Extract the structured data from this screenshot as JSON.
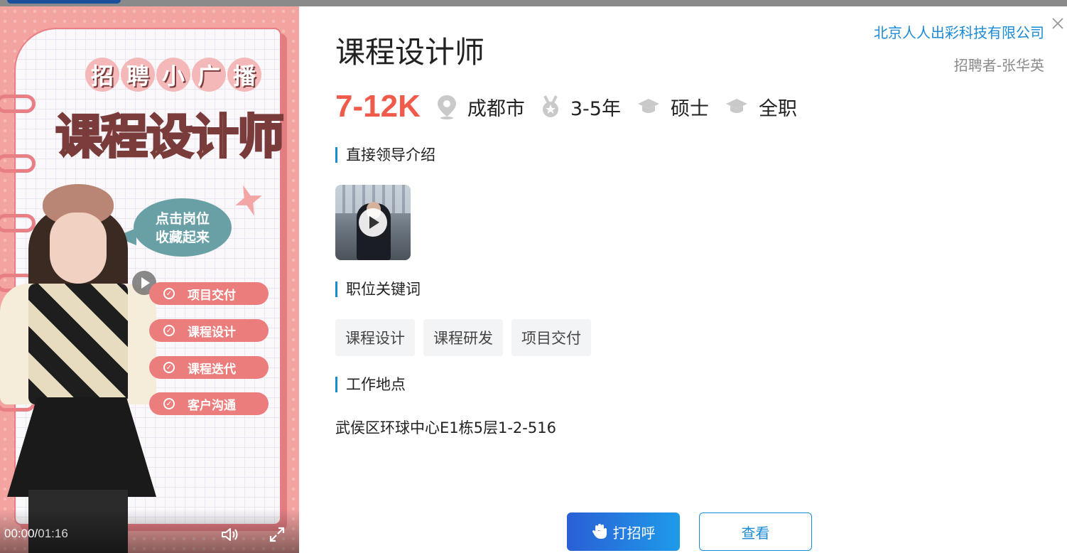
{
  "video": {
    "banner_chars": [
      "招",
      "聘",
      "小",
      "广",
      "播"
    ],
    "title": "课程设计师",
    "bubble_line1": "点击岗位",
    "bubble_line2": "收藏起来",
    "tags": [
      "项目交付",
      "课程设计",
      "课程迭代",
      "客户沟通"
    ],
    "time_current": "00:00/",
    "time_duration": "01:16"
  },
  "header": {
    "company": "北京人人出彩科技有限公司",
    "recruiter": "招聘者-张华英"
  },
  "job": {
    "title": "课程设计师",
    "salary": "7-12K",
    "location": "成都市",
    "experience": "3-5年",
    "education": "硕士",
    "type": "全职"
  },
  "sections": {
    "leader_intro": "直接领导介绍",
    "keywords_title": "职位关键词",
    "location_title": "工作地点"
  },
  "keywords": [
    "课程设计",
    "课程研发",
    "项目交付"
  ],
  "address": "武侯区环球中心E1栋5层1-2-516",
  "actions": {
    "greet": "打招呼",
    "view": "查看"
  },
  "colors": {
    "accent": "#1c8bd6",
    "salary": "#f05a4a"
  }
}
